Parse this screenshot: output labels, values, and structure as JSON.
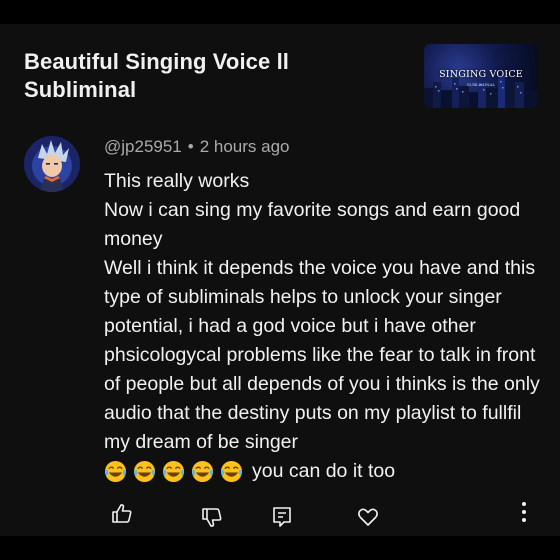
{
  "video": {
    "title": "Beautiful Singing Voice ll Subliminal",
    "thumbnail": {
      "text": "SINGING VOICE",
      "subtext": "SUBLIMINAL"
    }
  },
  "comment": {
    "author": "@jp25951",
    "separator": "•",
    "time": "2 hours ago",
    "lines": [
      "This really works",
      "Now i can sing my favorite songs and earn good money",
      "Well i think it depends the voice you have and this type of subliminals helps to unlock your singer potential, i had a god voice but i have other phsicologycal problems like the fear to talk in front of people but all depends of you i thinks is the only audio that the destiny puts on my playlist to fullfil my dream of be singer"
    ],
    "emoji": "face-with-tears-of-joy",
    "emoji_count": 5,
    "tail": "you can do it too"
  },
  "actions": [
    {
      "icon": "like-icon"
    },
    {
      "icon": "dislike-icon"
    },
    {
      "icon": "reply-icon"
    },
    {
      "icon": "heart-icon"
    },
    {
      "icon": "more-vertical-icon"
    }
  ],
  "colors": {
    "background": "#0f0f0f",
    "text": "#f1f1f1",
    "secondary_text": "#aaaaaa"
  }
}
